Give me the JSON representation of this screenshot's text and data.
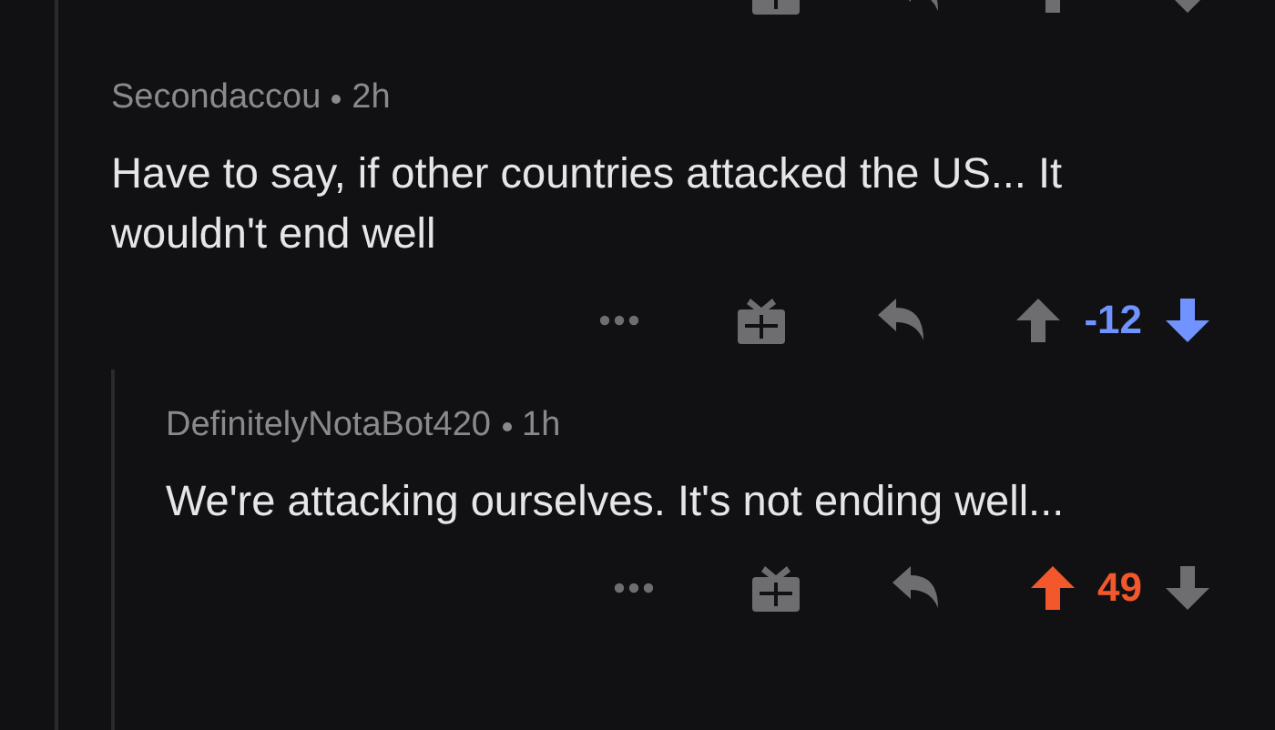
{
  "comments": [
    {
      "author": "Secondaccou",
      "age": "2h",
      "body": "Have to say, if other countries attacked the US... It wouldn't end well",
      "upvoted": false,
      "downvoted": true,
      "score": "-12"
    },
    {
      "author": "DefinitelyNotaBot420",
      "age": "1h",
      "body": "We're attacking ourselves. It's not ending well...",
      "upvoted": true,
      "downvoted": false,
      "score": "49"
    }
  ]
}
